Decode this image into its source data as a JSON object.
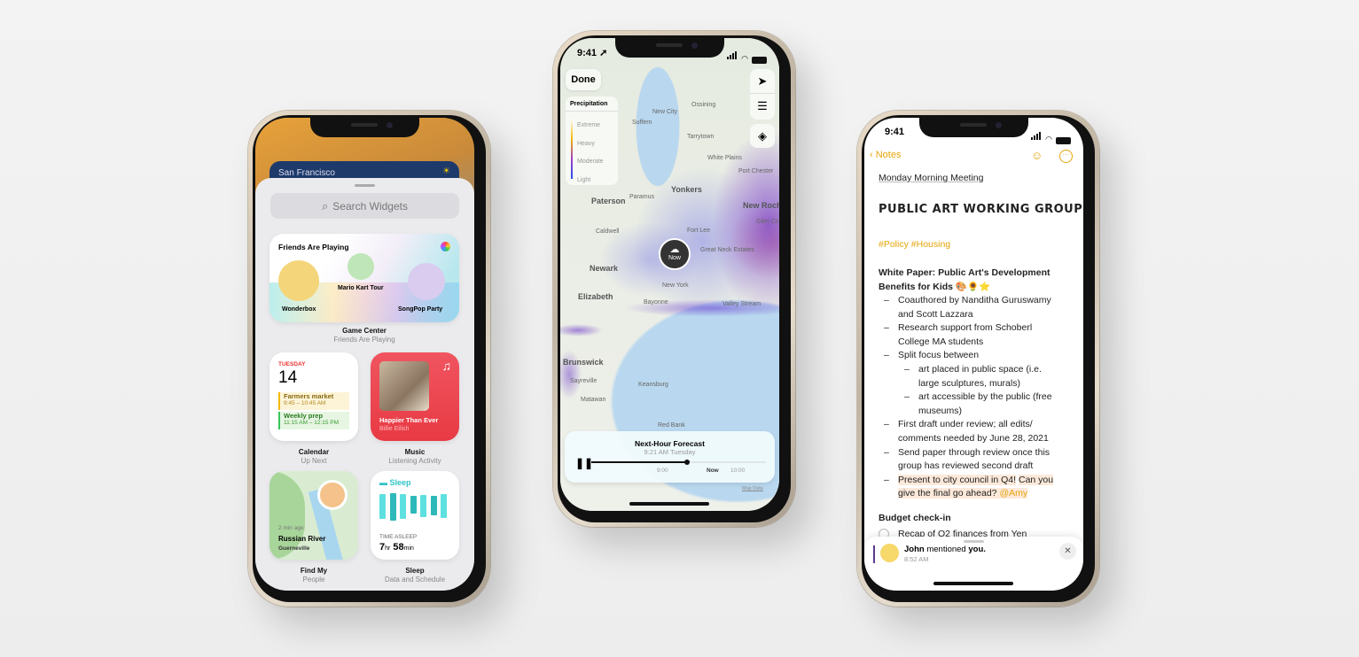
{
  "left_phone": {
    "weather_city": "San Francisco",
    "search_placeholder": "Search Widgets",
    "game_center": {
      "title": "Friends Are Playing",
      "friends": [
        "Wonderbox",
        "Mario Kart Tour",
        "SongPop Party"
      ],
      "label": "Game Center",
      "sublabel": "Friends Are Playing"
    },
    "calendar": {
      "day": "TUESDAY",
      "date": "14",
      "events": [
        {
          "title": "Farmers market",
          "time": "9:45 – 10:45 AM",
          "color": "#f5b800"
        },
        {
          "title": "Weekly prep",
          "time": "11:15 AM – 12:15 PM",
          "color": "#34c759"
        }
      ],
      "label": "Calendar",
      "sublabel": "Up Next"
    },
    "music": {
      "song": "Happier Than Ever",
      "artist": "Billie Eilish",
      "label": "Music",
      "sublabel": "Listening Activity",
      "color": "#f0424f"
    },
    "findmy": {
      "time": "2 min ago",
      "place": "Russian River",
      "town": "Guerneville",
      "label": "Find My",
      "sublabel": "People"
    },
    "sleep": {
      "title": "Sleep",
      "caption": "TIME ASLEEP",
      "hours": "7",
      "hr_unit": "hr",
      "minutes": "58",
      "min_unit": "min",
      "label": "Sleep",
      "sublabel": "Data and Schedule",
      "color": "#2ec4c6",
      "bars": [
        0.85,
        0.9,
        0.85,
        0.6,
        0.75,
        0.65,
        0.8
      ]
    }
  },
  "center_phone": {
    "time": "9:41",
    "done_label": "Done",
    "legend": {
      "title": "Precipitation",
      "levels": [
        "Extreme",
        "Heavy",
        "Moderate",
        "Light"
      ]
    },
    "map_labels": [
      "New City",
      "Ossining",
      "Suffern",
      "Tarrytown",
      "White Plains",
      "Port Chester",
      "Yonkers",
      "Paterson",
      "Paramus",
      "New Roch",
      "Glen Co",
      "Caldwell",
      "Fort Lee",
      "Great Neck Estates",
      "Newark",
      "New York",
      "Elizabeth",
      "Bayonne",
      "Valley Stream",
      "Brunswick",
      "Sayreville",
      "Keansburg",
      "Matawan",
      "Red Bank"
    ],
    "now_pin": "Now",
    "forecast": {
      "title": "Next-Hour Forecast",
      "subtitle": "9:21 AM Tuesday",
      "ticks": [
        "9:00",
        "Now",
        "10:00"
      ],
      "progress": 0.55
    },
    "map_data_link": "Map Data"
  },
  "right_phone": {
    "time": "9:41",
    "back_label": "Notes",
    "accent": "#e5a50a",
    "note_title": "Monday Morning Meeting",
    "heading": "PUBLIC ART WORKING GROUP",
    "tags": "#Policy #Housing",
    "subheading_1": "White Paper: Public Art's Development",
    "subheading_2": "Benefits for Kids 🎨🌻⭐",
    "bullets": [
      "–",
      "Coauthored by Nanditha Guruswamy",
      "and Scott Lazzara",
      "Research support from Schoberl",
      "College MA students",
      "Split focus between",
      "art placed in public space (i.e.",
      "large sculptures, murals)",
      "art accessible by the public (free",
      "museums)",
      "First draft under review; all edits/",
      "comments needed by June 28, 2021",
      "Send paper through review once this",
      "group has reviewed second draft",
      "Present to city council in Q4!",
      "Can you",
      "give the final go ahead?",
      "@Amy"
    ],
    "section": "Budget check-in",
    "todo": "Recap of Q2 finances from Yen",
    "notification": {
      "name": "John",
      "text": " mentioned ",
      "you": "you.",
      "time": "8:52 AM"
    }
  }
}
